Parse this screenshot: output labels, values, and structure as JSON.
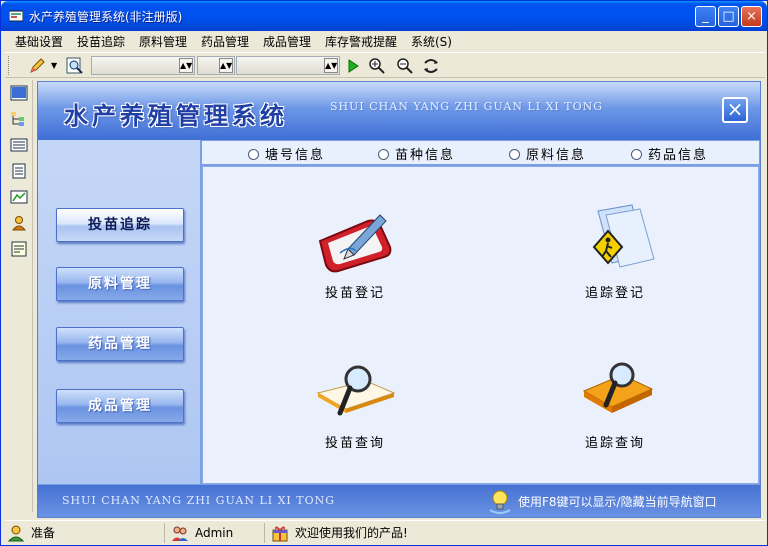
{
  "window": {
    "title": "水产养殖管理系统(非注册版)"
  },
  "window_controls": {
    "minimize": "_",
    "maximize": "□",
    "close": "×"
  },
  "menubar": {
    "items": [
      "基础设置",
      "投苗追踪",
      "原料管理",
      "药品管理",
      "成品管理",
      "库存警戒提醒",
      "系统(S)"
    ]
  },
  "banner": {
    "title": "水产养殖管理系统",
    "pinyin": "SHUI CHAN YANG ZHI GUAN LI XI TONG",
    "close": "×"
  },
  "nav": {
    "buttons": [
      "投苗追踪",
      "原料管理",
      "药品管理",
      "成品管理"
    ]
  },
  "tabs": [
    "塘号信息",
    "苗种信息",
    "原料信息",
    "药品信息"
  ],
  "functions": [
    {
      "label": "投苗登记",
      "icon": "pencil-slate-icon"
    },
    {
      "label": "追踪登记",
      "icon": "pedestrian-sign-folder-icon"
    },
    {
      "label": "投苗查询",
      "icon": "magnifier-book-icon"
    },
    {
      "label": "追踪查询",
      "icon": "magnifier-book-orange-icon"
    }
  ],
  "footer": {
    "pinyin": "SHUI CHAN YANG ZHI GUAN LI XI TONG",
    "tip": "使用F8键可以显示/隐藏当前导航窗口"
  },
  "statusbar": {
    "status": "准备",
    "user": "Admin",
    "message": "欢迎使用我们的产品!"
  },
  "colors": {
    "title_bar": "#0053ee",
    "main_bg": "#7aa0e3",
    "content_bg": "#eaf1fd",
    "banner_title": "#1f3fa5"
  }
}
